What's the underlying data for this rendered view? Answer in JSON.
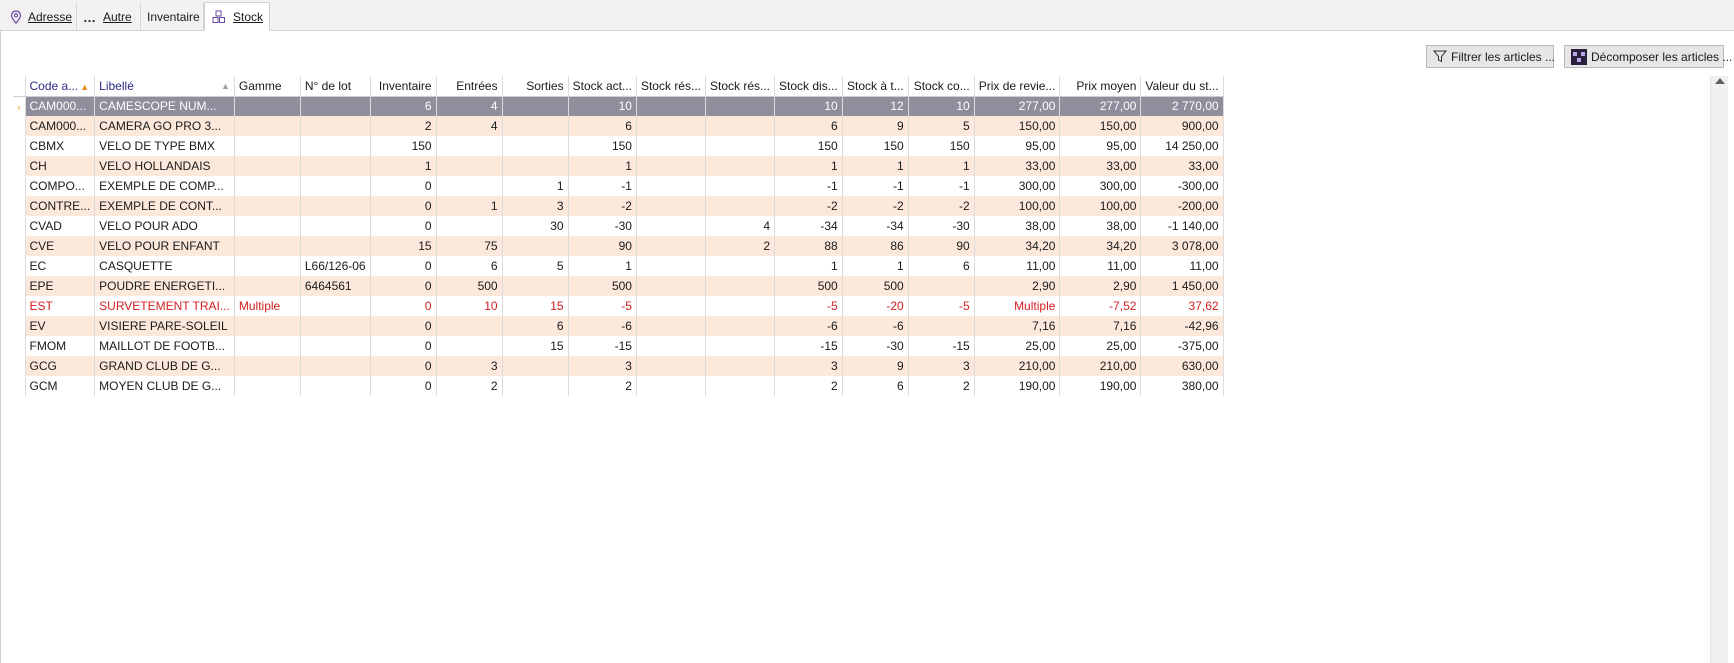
{
  "tabs": [
    {
      "label": "Adresse",
      "icon": "location-pin-icon",
      "active": false
    },
    {
      "label": "Autre",
      "icon": "ellipsis-icon",
      "active": false
    },
    {
      "label": "Inventaire",
      "icon": "",
      "active": false
    },
    {
      "label": "Stock",
      "icon": "stock-boxes-icon",
      "active": true
    }
  ],
  "toolbar": {
    "filter_label": "Filtrer les articles ...",
    "decompose_label": "Décomposer les articles ..."
  },
  "grid": {
    "columns": [
      "Code a...",
      "Libellé",
      "Gamme",
      "N° de lot",
      "Inventaire",
      "Entrées",
      "Sorties",
      "Stock act...",
      "Stock rés...",
      "Stock rés...",
      "Stock dis...",
      "Stock à t...",
      "Stock co...",
      "Prix de revie...",
      "Prix moyen",
      "Valeur du st..."
    ],
    "rows": [
      [
        "CAM000...",
        "CAMESCOPE NUM...",
        "",
        "",
        "6",
        "4",
        "",
        "10",
        "",
        "",
        "10",
        "12",
        "10",
        "277,00",
        "277,00",
        "2 770,00"
      ],
      [
        "CAM000...",
        "CAMERA GO PRO 3...",
        "",
        "",
        "2",
        "4",
        "",
        "6",
        "",
        "",
        "6",
        "9",
        "5",
        "150,00",
        "150,00",
        "900,00"
      ],
      [
        "CBMX",
        "VELO DE TYPE BMX",
        "",
        "",
        "150",
        "",
        "",
        "150",
        "",
        "",
        "150",
        "150",
        "150",
        "95,00",
        "95,00",
        "14 250,00"
      ],
      [
        "CH",
        "VELO HOLLANDAIS",
        "",
        "",
        "1",
        "",
        "",
        "1",
        "",
        "",
        "1",
        "1",
        "1",
        "33,00",
        "33,00",
        "33,00"
      ],
      [
        "COMPO...",
        "EXEMPLE DE COMP...",
        "",
        "",
        "0",
        "",
        "1",
        "-1",
        "",
        "",
        "-1",
        "-1",
        "-1",
        "300,00",
        "300,00",
        "-300,00"
      ],
      [
        "CONTRE...",
        "EXEMPLE DE CONT...",
        "",
        "",
        "0",
        "1",
        "3",
        "-2",
        "",
        "",
        "-2",
        "-2",
        "-2",
        "100,00",
        "100,00",
        "-200,00"
      ],
      [
        "CVAD",
        "VELO POUR ADO",
        "",
        "",
        "0",
        "",
        "30",
        "-30",
        "",
        "4",
        "-34",
        "-34",
        "-30",
        "38,00",
        "38,00",
        "-1 140,00"
      ],
      [
        "CVE",
        "VELO POUR ENFANT",
        "",
        "",
        "15",
        "75",
        "",
        "90",
        "",
        "2",
        "88",
        "86",
        "90",
        "34,20",
        "34,20",
        "3 078,00"
      ],
      [
        "EC",
        "CASQUETTE",
        "",
        "L66/126-06",
        "0",
        "6",
        "5",
        "1",
        "",
        "",
        "1",
        "1",
        "6",
        "11,00",
        "11,00",
        "11,00"
      ],
      [
        "EPE",
        "POUDRE ENERGETI...",
        "",
        "6464561",
        "0",
        "500",
        "",
        "500",
        "",
        "",
        "500",
        "500",
        "",
        "2,90",
        "2,90",
        "1 450,00"
      ],
      [
        "EST",
        "SURVETEMENT TRAI...",
        "Multiple",
        "",
        "0",
        "10",
        "15",
        "-5",
        "",
        "",
        "-5",
        "-20",
        "-5",
        "Multiple",
        "-7,52",
        "37,62"
      ],
      [
        "EV",
        "VISIERE PARE-SOLEIL",
        "",
        "",
        "0",
        "",
        "6",
        "-6",
        "",
        "",
        "-6",
        "-6",
        "",
        "7,16",
        "7,16",
        "-42,96"
      ],
      [
        "FMOM",
        "MAILLOT DE FOOTB...",
        "",
        "",
        "0",
        "",
        "15",
        "-15",
        "",
        "",
        "-15",
        "-30",
        "-15",
        "25,00",
        "25,00",
        "-375,00"
      ],
      [
        "GCG",
        "GRAND CLUB DE G...",
        "",
        "",
        "0",
        "3",
        "",
        "3",
        "",
        "",
        "3",
        "9",
        "3",
        "210,00",
        "210,00",
        "630,00"
      ],
      [
        "GCM",
        "MOYEN CLUB DE G...",
        "",
        "",
        "0",
        "2",
        "",
        "2",
        "",
        "",
        "2",
        "6",
        "2",
        "190,00",
        "190,00",
        "380,00"
      ]
    ],
    "selected_row": 0,
    "red_row": 10
  },
  "colors": {
    "selected_row": "#8e8e9c",
    "alt_row": "#fde8dc",
    "negative_text": "#d32020",
    "sort_arrow": "#e88a1a"
  }
}
